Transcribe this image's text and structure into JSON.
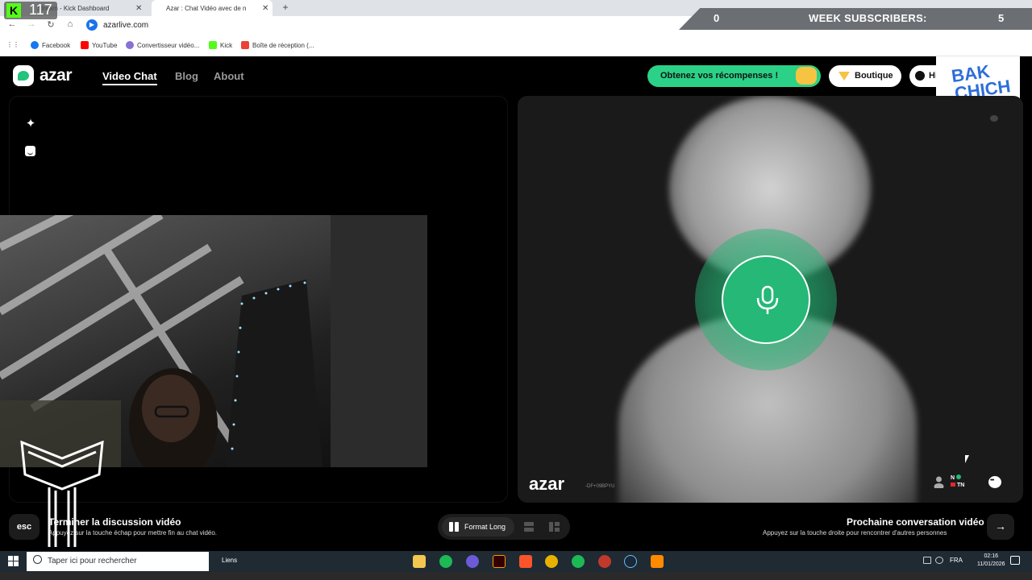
{
  "browser": {
    "tabs": [
      {
        "label": "Stream - Kick Dashboard"
      },
      {
        "label": "Azar : Chat Vidéo avec de n"
      }
    ],
    "url": "azarlive.com",
    "bookmarks": [
      "Facebook",
      "YouTube",
      "Convertisseur vidéo...",
      "Kick",
      "Boîte de réception (..."
    ]
  },
  "overlay": {
    "viewer_count": "117",
    "sub_count": "0",
    "week_label": "WEEK SUBSCRIBERS:",
    "week_subs": "5",
    "brand": "BAK CHICH"
  },
  "azar": {
    "logo": "azar",
    "nav": {
      "video_chat": "Video Chat",
      "blog": "Blog",
      "about": "About"
    },
    "rewards_label": "Obtenez vos récompenses !",
    "shop_label": "Boutique",
    "history_label": "Hi",
    "watermark": "azar",
    "partner_id": "-DF+09BPYU",
    "partner_country_top": "N",
    "partner_country": "TN"
  },
  "bottom": {
    "esc_label": "esc",
    "end_title": "Terminer la discussion vidéo",
    "end_desc": "Appuyez sur la touche échap pour mettre fin au chat vidéo.",
    "format_long": "Format Long",
    "next_title": "Prochaine conversation vidéo",
    "next_desc": "Appuyez sur la touche droite pour rencontrer d'autres personnes"
  },
  "taskbar": {
    "search_placeholder": "Taper ici pour rechercher",
    "links": "Liens",
    "lang": "FRA",
    "time": "02:16",
    "date": "11/01/2026"
  },
  "colors": {
    "accent_green": "#2bd187",
    "mic_green": "#25b877",
    "kick_green": "#53fc18"
  }
}
